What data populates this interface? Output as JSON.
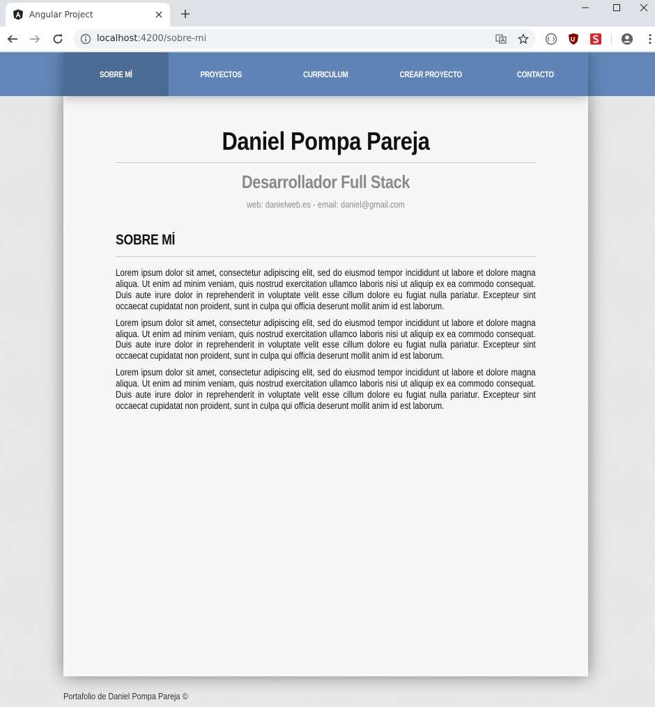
{
  "browser": {
    "tab_title": "Angular Project",
    "url_host": "localhost",
    "url_path": ":4200/sobre-mi"
  },
  "nav": {
    "items": [
      {
        "label": "SOBRE MÍ",
        "active": true
      },
      {
        "label": "PROYECTOS",
        "active": false
      },
      {
        "label": "CURRICULUM",
        "active": false
      },
      {
        "label": "CREAR PROYECTO",
        "active": false
      },
      {
        "label": "CONTACTO",
        "active": false
      }
    ]
  },
  "profile": {
    "name": "Daniel Pompa Pareja",
    "role": "Desarrollador Full Stack",
    "contact": "web: danielweb.es - email: daniel@gmail.com"
  },
  "about": {
    "title": "SOBRE MÍ",
    "paragraphs": [
      "Lorem ipsum dolor sit amet, consectetur adipiscing elit, sed do eiusmod tempor incididunt ut labore et dolore magna aliqua. Ut enim ad minim veniam, quis nostrud exercitation ullamco laboris nisi ut aliquip ex ea commodo consequat. Duis aute irure dolor in reprehenderit in voluptate velit esse cillum dolore eu fugiat nulla pariatur. Excepteur sint occaecat cupidatat non proident, sunt in culpa qui officia deserunt mollit anim id est laborum.",
      "Lorem ipsum dolor sit amet, consectetur adipiscing elit, sed do eiusmod tempor incididunt ut labore et dolore magna aliqua. Ut enim ad minim veniam, quis nostrud exercitation ullamco laboris nisi ut aliquip ex ea commodo consequat. Duis aute irure dolor in reprehenderit in voluptate velit esse cillum dolore eu fugiat nulla pariatur. Excepteur sint occaecat cupidatat non proident, sunt in culpa qui officia deserunt mollit anim id est laborum.",
      "Lorem ipsum dolor sit amet, consectetur adipiscing elit, sed do eiusmod tempor incididunt ut labore et dolore magna aliqua. Ut enim ad minim veniam, quis nostrud exercitation ullamco laboris nisi ut aliquip ex ea commodo consequat. Duis aute irure dolor in reprehenderit in voluptate velit esse cillum dolore eu fugiat nulla pariatur. Excepteur sint occaecat cupidatat non proident, sunt in culpa qui officia deserunt mollit anim id est laborum."
    ]
  },
  "footer": {
    "text": "Portafolio de Daniel Pompa Pareja ©"
  },
  "colors": {
    "nav_bg": "#5f84b5",
    "nav_active": "#4b6a94",
    "sheet_bg": "#f7f7f7"
  }
}
